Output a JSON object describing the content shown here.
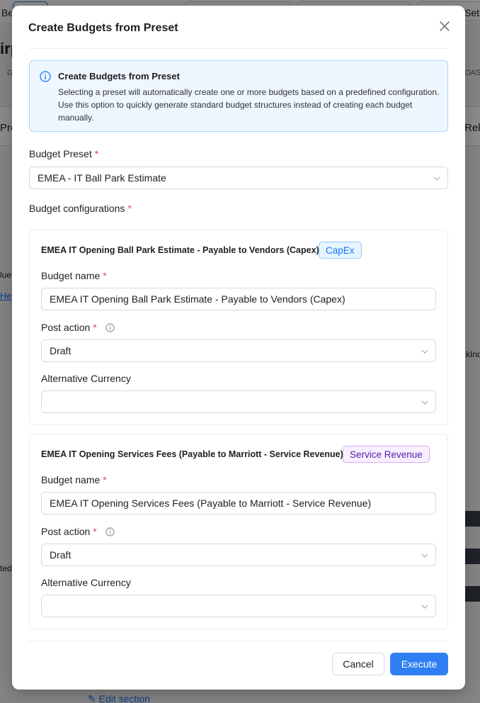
{
  "background": {
    "frag_top_left": "Be",
    "frag_top_right": "Set",
    "frag_title": "irp",
    "frag_g": "G",
    "frag_oase": "OAS",
    "frag_pro": "Pro",
    "frag_rel": "Rel",
    "frag_lue": "lue",
    "frag_he": "He",
    "frag_kind": "kInd",
    "frag_ted": "ted",
    "edit_section": "Edit section"
  },
  "modal": {
    "title": "Create Budgets from Preset",
    "info": {
      "title": "Create Budgets from Preset",
      "text": "Selecting a preset will automatically create one or more budgets based on a predefined configuration. Use this option to quickly generate standard budget structures instead of creating each budget manually."
    },
    "preset": {
      "label": "Budget Preset",
      "required_mark": "*",
      "value": "EMEA - IT Ball Park Estimate"
    },
    "configs_label": "Budget configurations",
    "configs": [
      {
        "title": "EMEA IT Opening Ball Park Estimate - Payable to Vendors (Capex)",
        "tag": "CapEx",
        "name_label": "Budget name",
        "name_value": "EMEA IT Opening Ball Park Estimate - Payable to Vendors (Capex)",
        "post_action_label": "Post action",
        "post_action_value": "Draft",
        "alt_currency_label": "Alternative Currency",
        "alt_currency_value": ""
      },
      {
        "title": "EMEA IT Opening Services Fees (Payable to Marriott - Service Revenue)",
        "tag": "Service Revenue",
        "name_label": "Budget name",
        "name_value": "EMEA IT Opening Services Fees (Payable to Marriott - Service Revenue)",
        "post_action_label": "Post action",
        "post_action_value": "Draft",
        "alt_currency_label": "Alternative Currency",
        "alt_currency_value": ""
      }
    ],
    "buttons": {
      "cancel": "Cancel",
      "execute": "Execute"
    }
  },
  "colors": {
    "primary": "#2f7ff2",
    "info_bg": "#eef6ff",
    "info_border": "#a9d4ff",
    "required": "#e5484d",
    "tag_capex": "#1677ff",
    "tag_service": "#531dab"
  },
  "icons": {
    "close": "close-icon",
    "info": "info-circle-icon",
    "help": "help-circle-icon",
    "dropdown": "chevron-down-icon"
  }
}
